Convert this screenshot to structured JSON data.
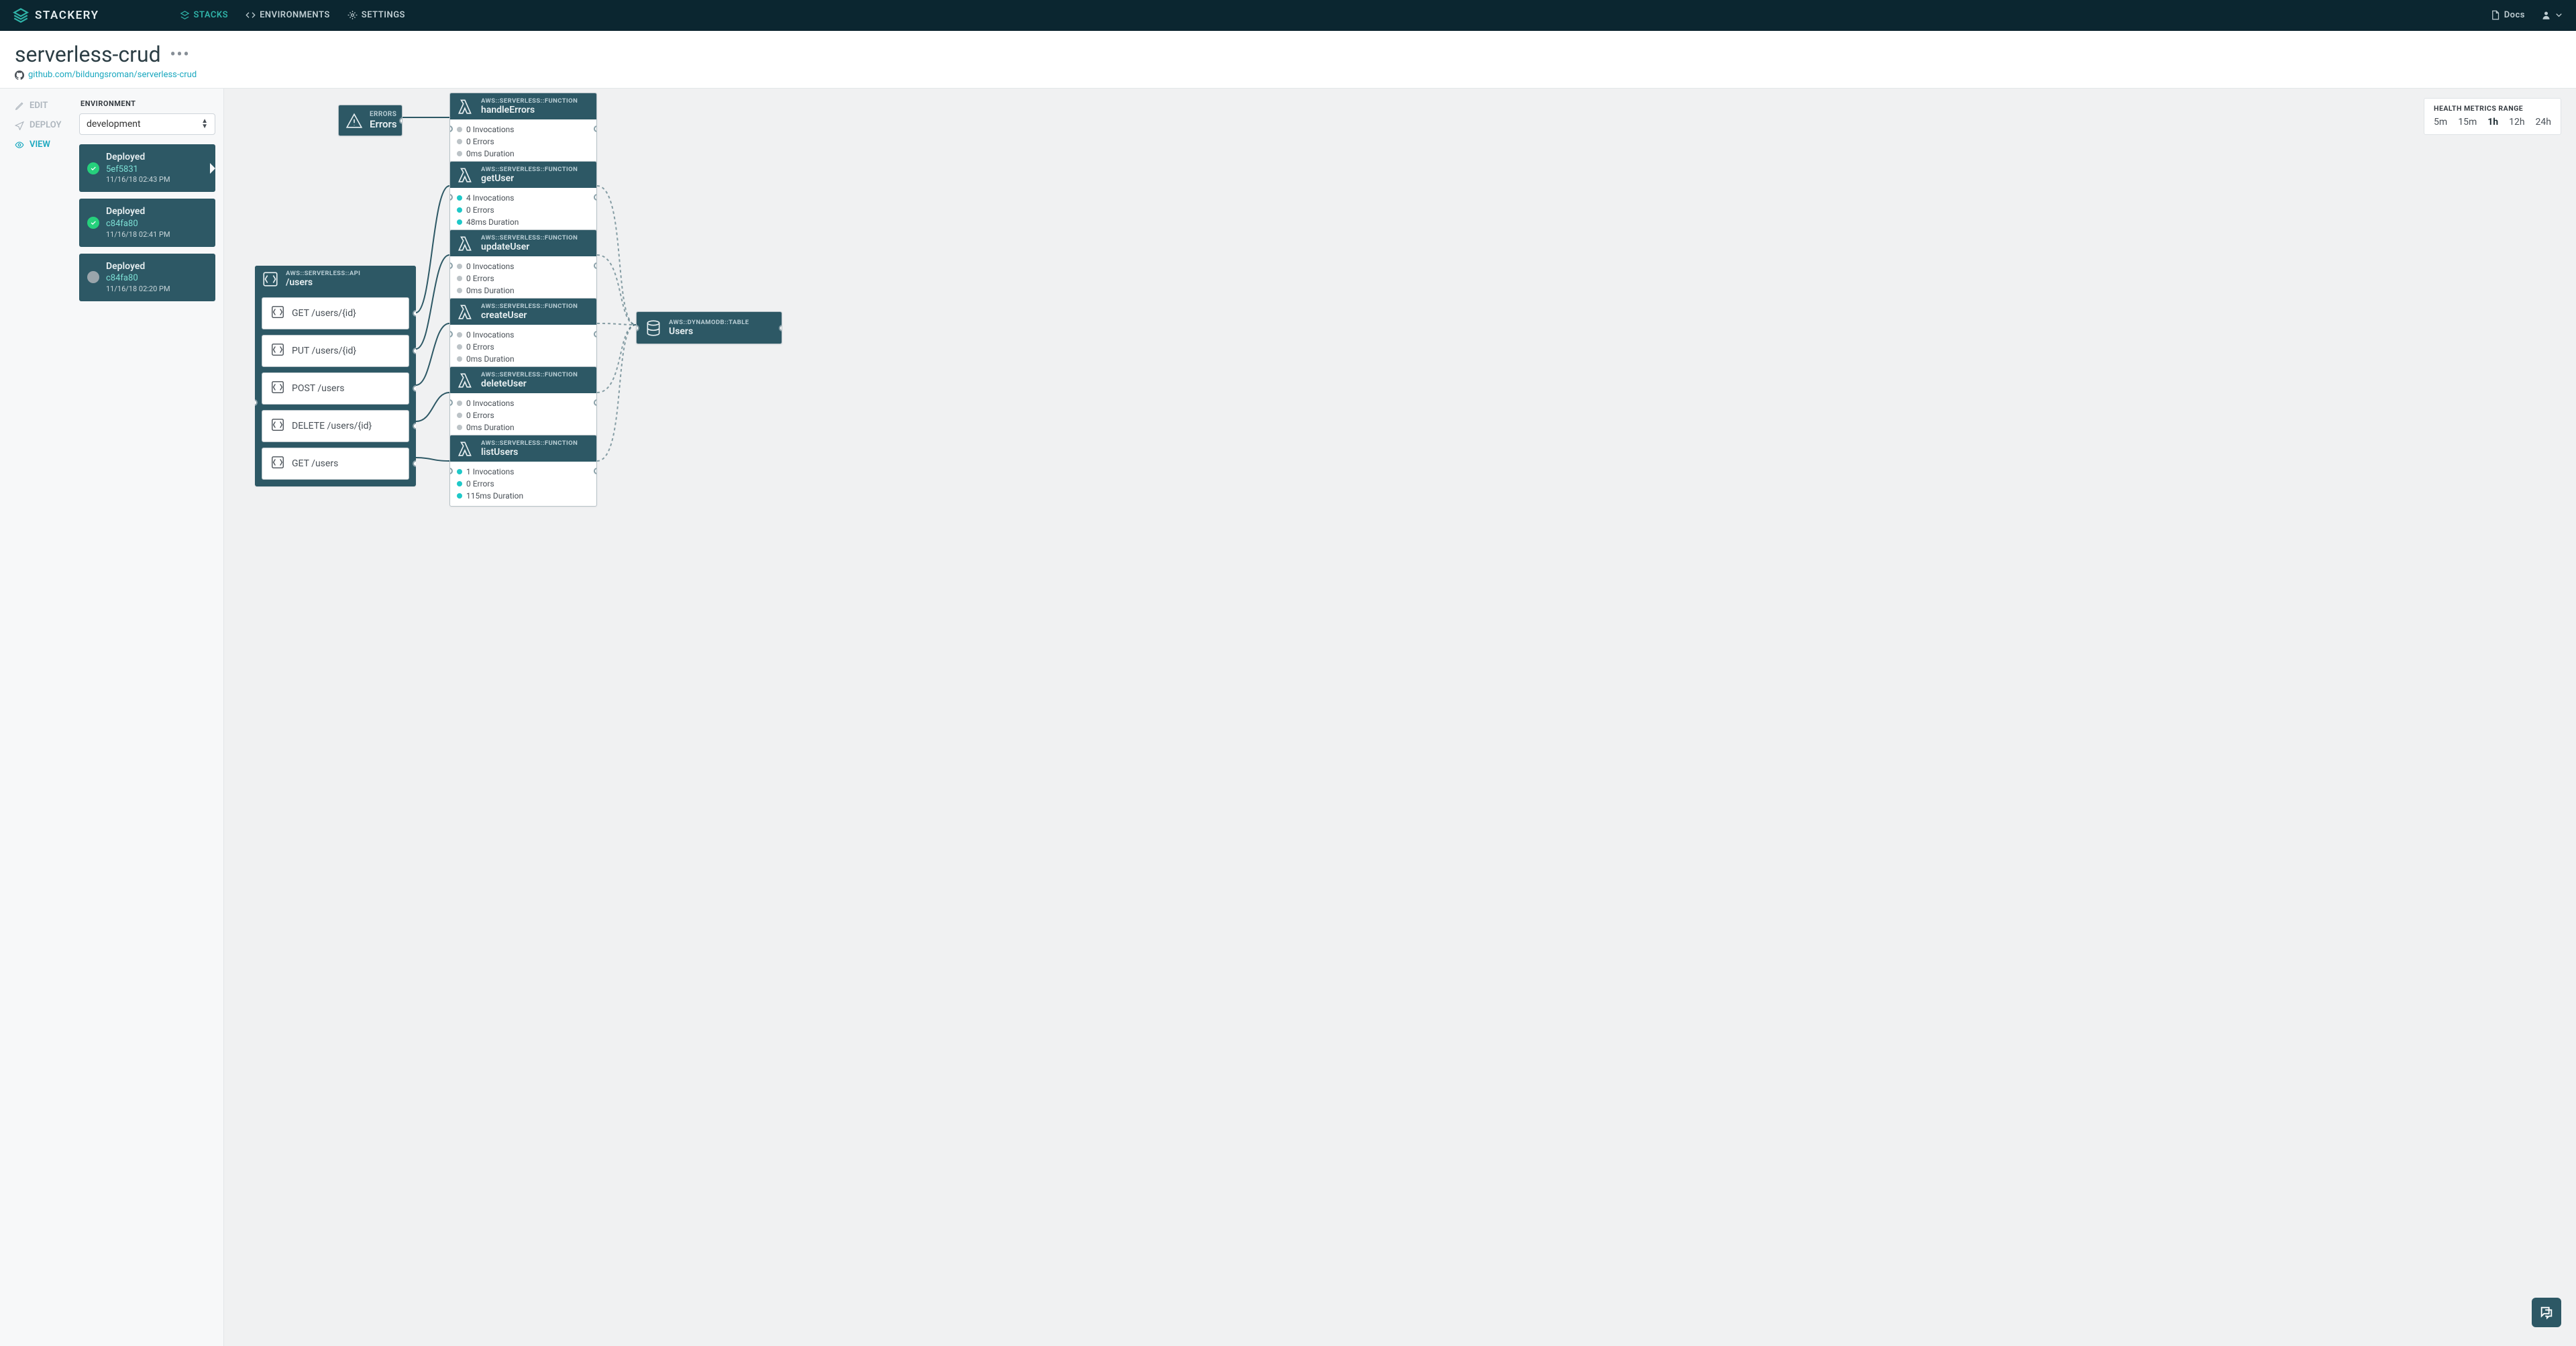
{
  "brand": "STACKERY",
  "nav": {
    "stacks": "STACKS",
    "environments": "ENVIRONMENTS",
    "settings": "SETTINGS",
    "docs": "Docs"
  },
  "page": {
    "title": "serverless-crud",
    "repo": "github.com/bildungsroman/serverless-crud"
  },
  "rail": {
    "edit": "EDIT",
    "deploy": "DEPLOY",
    "view": "VIEW"
  },
  "env": {
    "label": "ENVIRONMENT",
    "selected": "development"
  },
  "deployments": [
    {
      "status": "Deployed",
      "hash": "5ef5831",
      "ts": "11/16/18 02:43 PM",
      "ok": true,
      "active": true
    },
    {
      "status": "Deployed",
      "hash": "c84fa80",
      "ts": "11/16/18 02:41 PM",
      "ok": true,
      "active": false
    },
    {
      "status": "Deployed",
      "hash": "c84fa80",
      "ts": "11/16/18 02:20 PM",
      "ok": false,
      "active": false
    }
  ],
  "metrics_panel": {
    "title": "HEALTH METRICS RANGE",
    "ranges": [
      "5m",
      "15m",
      "1h",
      "12h",
      "24h"
    ],
    "active": "1h"
  },
  "nodes": {
    "errors": {
      "res": "ERRORS",
      "name": "Errors"
    },
    "api": {
      "res": "AWS::SERVERLESS::API",
      "name": "/users",
      "routes": [
        "GET /users/{id}",
        "PUT /users/{id}",
        "POST /users",
        "DELETE /users/{id}",
        "GET /users"
      ]
    },
    "fn_res": "AWS::SERVERLESS::FUNCTION",
    "handleErrors": {
      "name": "handleErrors",
      "m": [
        "0 Invocations",
        "0 Errors",
        "0ms Duration"
      ],
      "active": false
    },
    "getUser": {
      "name": "getUser",
      "m": [
        "4 Invocations",
        "0 Errors",
        "48ms Duration"
      ],
      "active": true
    },
    "updateUser": {
      "name": "updateUser",
      "m": [
        "0 Invocations",
        "0 Errors",
        "0ms Duration"
      ],
      "active": false
    },
    "createUser": {
      "name": "createUser",
      "m": [
        "0 Invocations",
        "0 Errors",
        "0ms Duration"
      ],
      "active": false
    },
    "deleteUser": {
      "name": "deleteUser",
      "m": [
        "0 Invocations",
        "0 Errors",
        "0ms Duration"
      ],
      "active": false
    },
    "listUsers": {
      "name": "listUsers",
      "m": [
        "1 Invocations",
        "0 Errors",
        "115ms Duration"
      ],
      "active": true
    },
    "table": {
      "res": "AWS::DYNAMODB::TABLE",
      "name": "Users"
    }
  }
}
